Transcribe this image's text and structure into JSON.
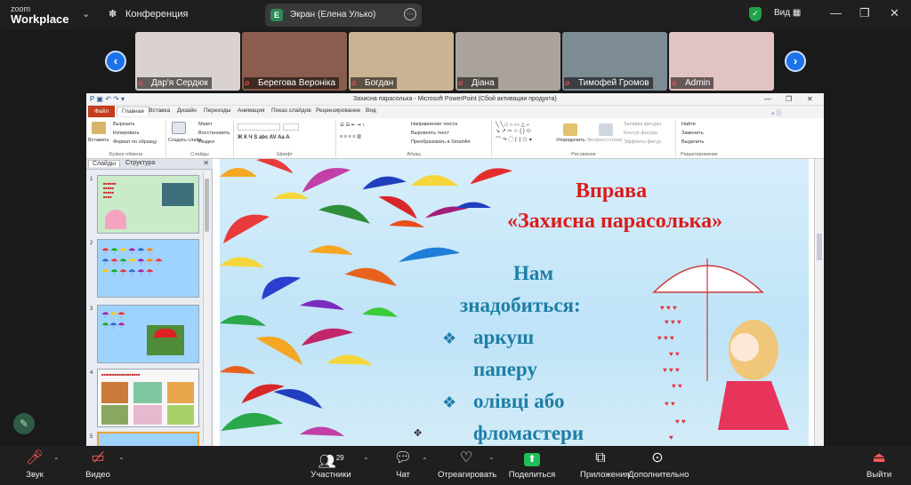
{
  "app": {
    "logo_top": "zoom",
    "logo_bottom": "Workplace",
    "conference": "Конференция",
    "view": "Вид"
  },
  "share_pill": {
    "badge": "E",
    "label": "Экран (Елена Улько)"
  },
  "participants": [
    {
      "name": "Дар'я Сердюк",
      "bg": "#d9d2cf"
    },
    {
      "name": "Берегова Вероніка",
      "bg": "#8a5d4e"
    },
    {
      "name": "Богдан",
      "bg": "#c9b392"
    },
    {
      "name": "Діана",
      "bg": "#a9a39c"
    },
    {
      "name": "Тимофей Громов",
      "bg": "#7d8b93"
    },
    {
      "name": "Admin",
      "bg": "#e2c3c3"
    }
  ],
  "powerpoint": {
    "title": "Захисна парасолька - Microsoft PowerPoint (Сбой активации продукта)",
    "tabs": [
      "Файл",
      "Главная",
      "Вставка",
      "Дизайн",
      "Переходы",
      "Анимация",
      "Показ слайдов",
      "Рецензирование",
      "Вид"
    ],
    "ribbon": {
      "paste": "Вставить",
      "cut": "Вырезать",
      "copy": "Копировать",
      "format_painter": "Формат по образцу",
      "clipboard": "Буфер обмена",
      "new_slide": "Создать слайд",
      "layout": "Макет",
      "reset": "Восстановить",
      "section": "Раздел",
      "slides": "Слайды",
      "font": "Шрифт",
      "paragraph": "Абзац",
      "text_dir": "Направление текста",
      "align_text": "Выровнять текст",
      "smartart": "Преобразовать в SmartArt",
      "arrange": "Упорядочить",
      "quick_styles": "Экспресс-стили",
      "shape_fill": "Заливка фигуры",
      "shape_outline": "Контур фигуры",
      "shape_effects": "Эффекты фигур",
      "drawing": "Рисование",
      "find": "Найти",
      "replace": "Заменить",
      "select": "Выделить",
      "editing": "Редактирование"
    },
    "panel_tabs": [
      "Слайды",
      "Структура"
    ],
    "slide_numbers": [
      "1",
      "2",
      "3",
      "4",
      "5"
    ]
  },
  "slide": {
    "title1": "Вправа",
    "title2": "«Захисна парасолька»",
    "line1": "Нам",
    "line2": "знадобиться:",
    "item1a": "аркуш",
    "item1b": "паперу",
    "item2a": "олівці або",
    "item2b": "фломастери"
  },
  "toolbar": {
    "mute": "Звук",
    "video": "Видео",
    "participants": "Участники",
    "participants_count": "29",
    "chat": "Чат",
    "react": "Отреагировать",
    "share": "Поделиться",
    "apps": "Приложения",
    "more": "Дополнительно",
    "leave": "Выйти"
  },
  "colors": {
    "accent": "#1a73e8",
    "share_green": "#1fbf5a",
    "slide_red": "#d91c1c",
    "slide_teal": "#1e7fa6"
  }
}
